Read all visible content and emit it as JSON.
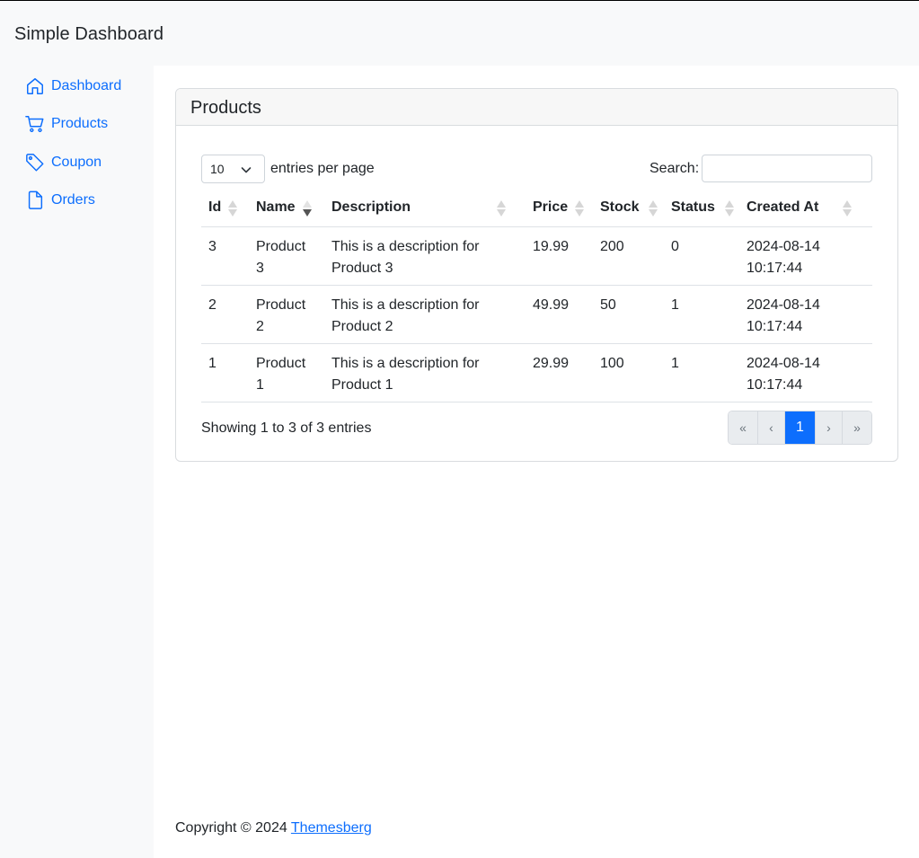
{
  "app": {
    "brand": "Simple Dashboard"
  },
  "sidebar": {
    "items": [
      {
        "label": "Dashboard",
        "icon": "house-icon"
      },
      {
        "label": "Products",
        "icon": "cart-icon"
      },
      {
        "label": "Coupon",
        "icon": "tag-icon"
      },
      {
        "label": "Orders",
        "icon": "file-icon"
      }
    ]
  },
  "card": {
    "title": "Products"
  },
  "table_controls": {
    "per_page_value": "10",
    "per_page_label": "entries per page",
    "search_label": "Search:",
    "search_value": ""
  },
  "table": {
    "columns": [
      "Id",
      "Name",
      "Description",
      "Price",
      "Stock",
      "Status",
      "Created At"
    ],
    "sorted_column": "Name",
    "sort_direction": "desc",
    "rows": [
      {
        "id": "3",
        "name": "Product 3",
        "description": "This is a description for Product 3",
        "price": "19.99",
        "stock": "200",
        "status": "0",
        "created_date": "2024-08-14",
        "created_time": "10:17:44"
      },
      {
        "id": "2",
        "name": "Product 2",
        "description": "This is a description for Product 2",
        "price": "49.99",
        "stock": "50",
        "status": "1",
        "created_date": "2024-08-14",
        "created_time": "10:17:44"
      },
      {
        "id": "1",
        "name": "Product 1",
        "description": "This is a description for Product 1",
        "price": "29.99",
        "stock": "100",
        "status": "1",
        "created_date": "2024-08-14",
        "created_time": "10:17:44"
      }
    ]
  },
  "pagination": {
    "info": "Showing 1 to 3 of 3 entries",
    "first": "«",
    "prev": "‹",
    "current": "1",
    "next": "›",
    "last": "»"
  },
  "footer": {
    "text": "Copyright © 2024 ",
    "link": "Themesberg"
  },
  "colors": {
    "accent": "#0d6efd",
    "sidebar_bg": "#f8f9fa",
    "card_header_bg": "#f7f7f7"
  }
}
